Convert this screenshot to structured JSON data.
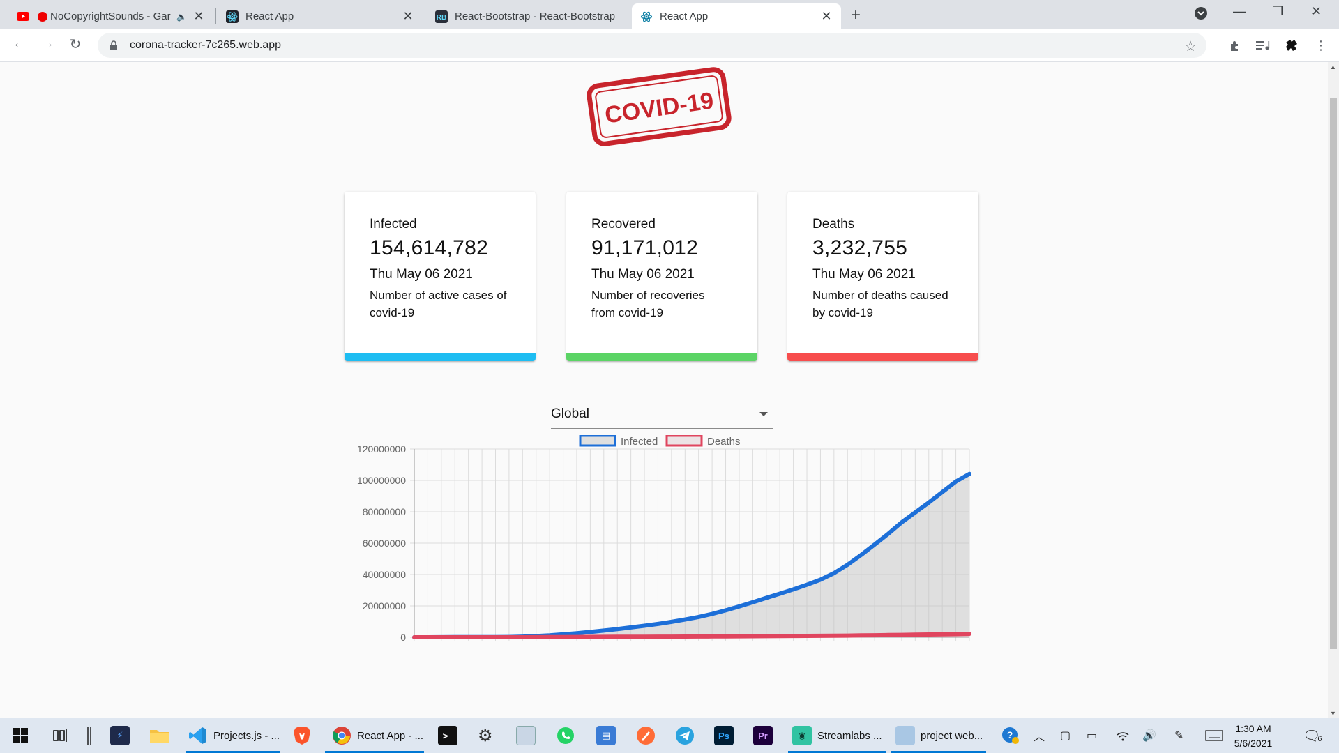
{
  "browser": {
    "tabs": [
      {
        "title": "NoCopyrightSounds - Gar",
        "icon": "youtube-icon",
        "audio": true
      },
      {
        "title": "React App",
        "icon": "react-icon"
      },
      {
        "title": "React-Bootstrap · React-Bootstrap",
        "icon": "react-bootstrap-icon"
      },
      {
        "title": "React App",
        "icon": "react-icon",
        "active": true
      }
    ],
    "url": "corona-tracker-7c265.web.app"
  },
  "page": {
    "logo_text": "COVID-19",
    "cards": [
      {
        "label": "Infected",
        "value": "154,614,782",
        "date": "Thu May 06 2021",
        "desc": "Number of active cases of covid-19",
        "color": "#1ebdf2"
      },
      {
        "label": "Recovered",
        "value": "91,171,012",
        "date": "Thu May 06 2021",
        "desc": "Number of recoveries from covid-19",
        "color": "#5bd465"
      },
      {
        "label": "Deaths",
        "value": "3,232,755",
        "date": "Thu May 06 2021",
        "desc": "Number of deaths caused by covid-19",
        "color": "#f74d4d"
      }
    ],
    "country_select": {
      "value": "Global"
    }
  },
  "chart_data": {
    "type": "line",
    "series": [
      {
        "name": "Infected",
        "color": "#1d6fd8",
        "fill": "rgba(190,190,190,0.45)",
        "values": [
          555,
          9927,
          40553,
          75641,
          84124,
          97886,
          125865,
          199687,
          413468,
          783360,
          1212345,
          1876543,
          2546478,
          3367567,
          4258345,
          5212345,
          6254345,
          7353456,
          8508743,
          9819023,
          11269345,
          12941123,
          14904567,
          17176234,
          19685345,
          22318765,
          25102345,
          27789765,
          30512345,
          33478123,
          36712345,
          40876987,
          46234123,
          52456789,
          59123456,
          65912345,
          73234567,
          79512345,
          85876543,
          92567123,
          99234567,
          104123456
        ]
      },
      {
        "name": "Deaths",
        "color": "#e0455f",
        "fill": "rgba(220,200,205,0.45)",
        "values": [
          17,
          213,
          910,
          1870,
          2872,
          3349,
          4643,
          8843,
          21298,
          42354,
          82074,
          125000,
          170000,
          210000,
          255000,
          290000,
          315000,
          350000,
          380000,
          420000,
          460000,
          505000,
          550000,
          590000,
          635000,
          680000,
          730000,
          780000,
          830000,
          880000,
          940000,
          1000000,
          1080000,
          1180000,
          1300000,
          1420000,
          1530000,
          1650000,
          1760000,
          1870000,
          1980000,
          2200000
        ]
      }
    ],
    "ylim": [
      0,
      120000000
    ],
    "yticks": [
      "120000000",
      "100000000",
      "80000000",
      "60000000",
      "40000000",
      "20000000",
      "0"
    ],
    "legend_position": "top",
    "grid": true
  },
  "taskbar": {
    "items": [
      {
        "label": "",
        "icon": "task-view-icon"
      },
      {
        "label": "",
        "icon": "slack-like-icon"
      },
      {
        "label": "",
        "icon": "file-explorer-icon"
      },
      {
        "label": "Projects.js - ...",
        "icon": "vscode-icon"
      },
      {
        "label": "",
        "icon": "brave-icon"
      },
      {
        "label": "React App - ...",
        "icon": "chrome-icon"
      },
      {
        "label": "",
        "icon": "terminal-icon"
      },
      {
        "label": "",
        "icon": "settings-icon"
      },
      {
        "label": "Streamlabs ...",
        "icon": "streamlabs-icon"
      },
      {
        "label": "project web...",
        "icon": "document-icon"
      }
    ],
    "clock_time": "1:30 AM",
    "clock_date": "5/6/2021",
    "notification_count": "6"
  }
}
